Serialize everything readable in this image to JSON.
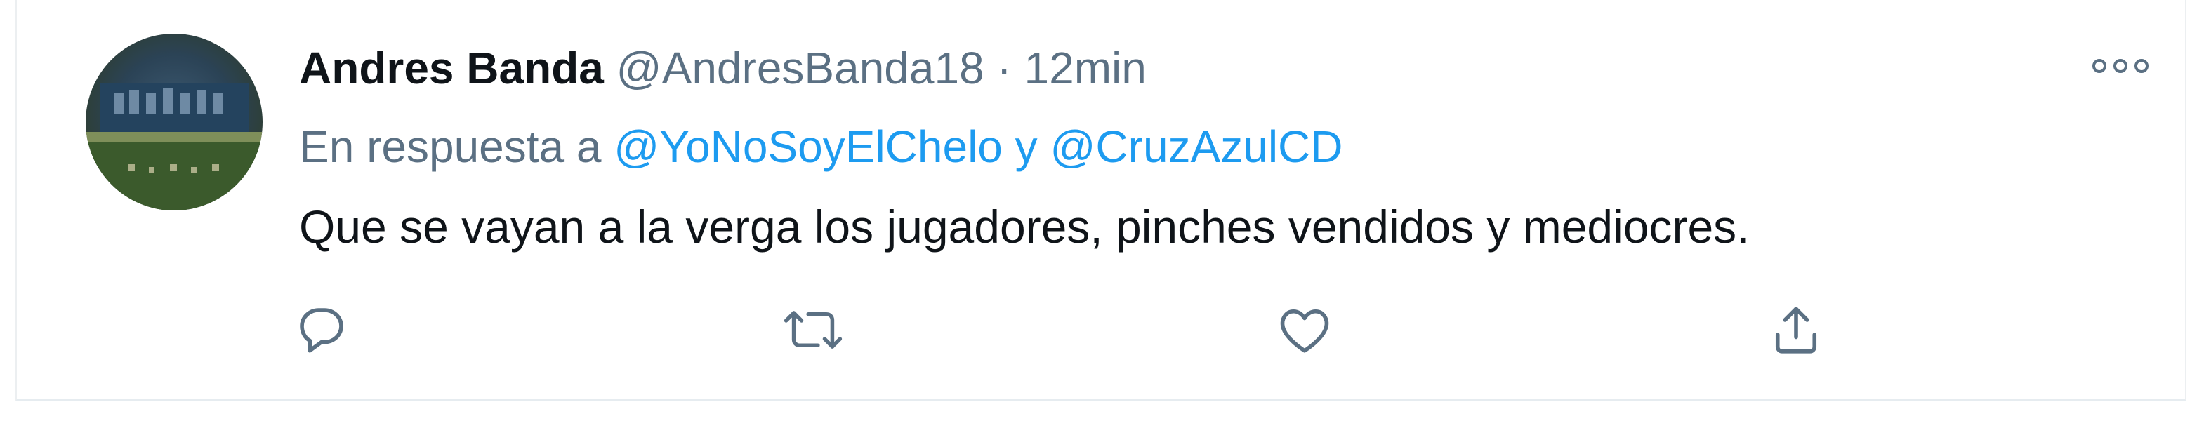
{
  "tweet": {
    "display_name": "Andres Banda",
    "handle": "@AndresBanda18",
    "separator": "·",
    "time": "12min",
    "reply_prefix": "En respuesta a",
    "reply_mentions": [
      "@YoNoSoyElChelo",
      "@CruzAzulCD"
    ],
    "reply_joiner": "y",
    "text": "Que se vayan a la verga los jugadores, pinches vendidos y mediocres."
  },
  "icons": {
    "more": "more-dots-icon",
    "reply": "reply-bubble-icon",
    "retweet": "retweet-icon",
    "like": "heart-icon",
    "share": "share-upload-icon"
  },
  "colors": {
    "text_primary": "#0f1419",
    "text_secondary": "#5b7083",
    "link": "#1d9bf0",
    "icon": "#5b7083",
    "border": "#eceff1"
  }
}
